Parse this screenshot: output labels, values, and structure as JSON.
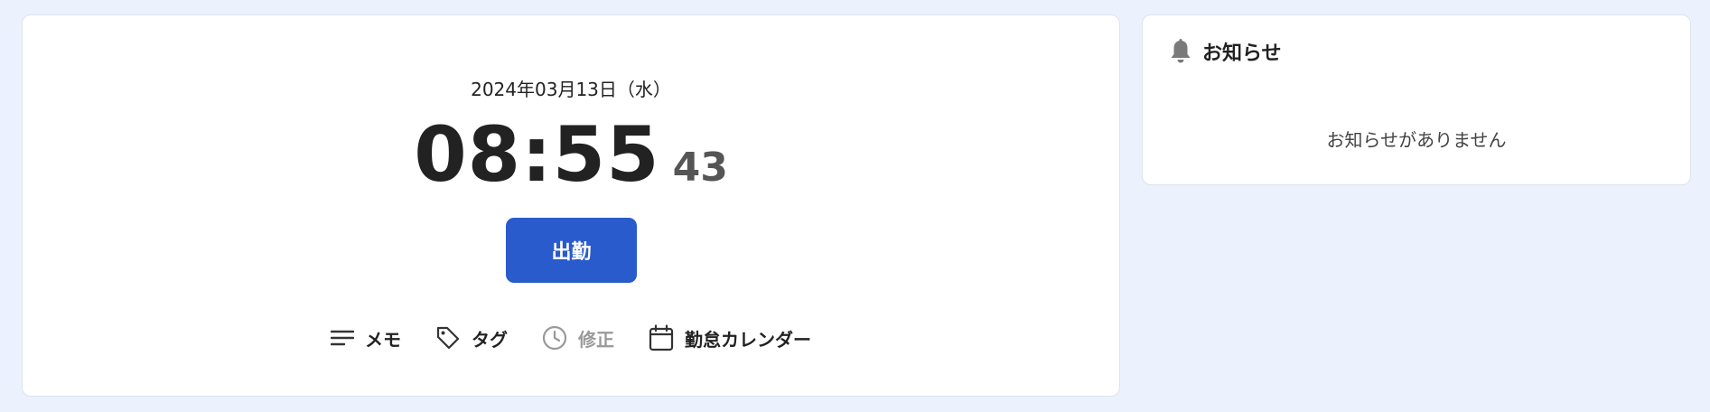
{
  "clock": {
    "date": "2024年03月13日（水）",
    "time": "08:55",
    "seconds": "43",
    "punch_button": "出勤"
  },
  "actions": [
    {
      "label": "メモ",
      "icon": "memo-lines-icon",
      "enabled": true
    },
    {
      "label": "タグ",
      "icon": "tag-icon",
      "enabled": true
    },
    {
      "label": "修正",
      "icon": "clock-icon",
      "enabled": false
    },
    {
      "label": "勤怠カレンダー",
      "icon": "calendar-icon",
      "enabled": true
    }
  ],
  "notice": {
    "title": "お知らせ",
    "icon": "bell-icon",
    "empty_message": "お知らせがありません"
  },
  "colors": {
    "background": "#ebf2fd",
    "primary_button": "#2a5bcc",
    "disabled_text": "#999999"
  }
}
